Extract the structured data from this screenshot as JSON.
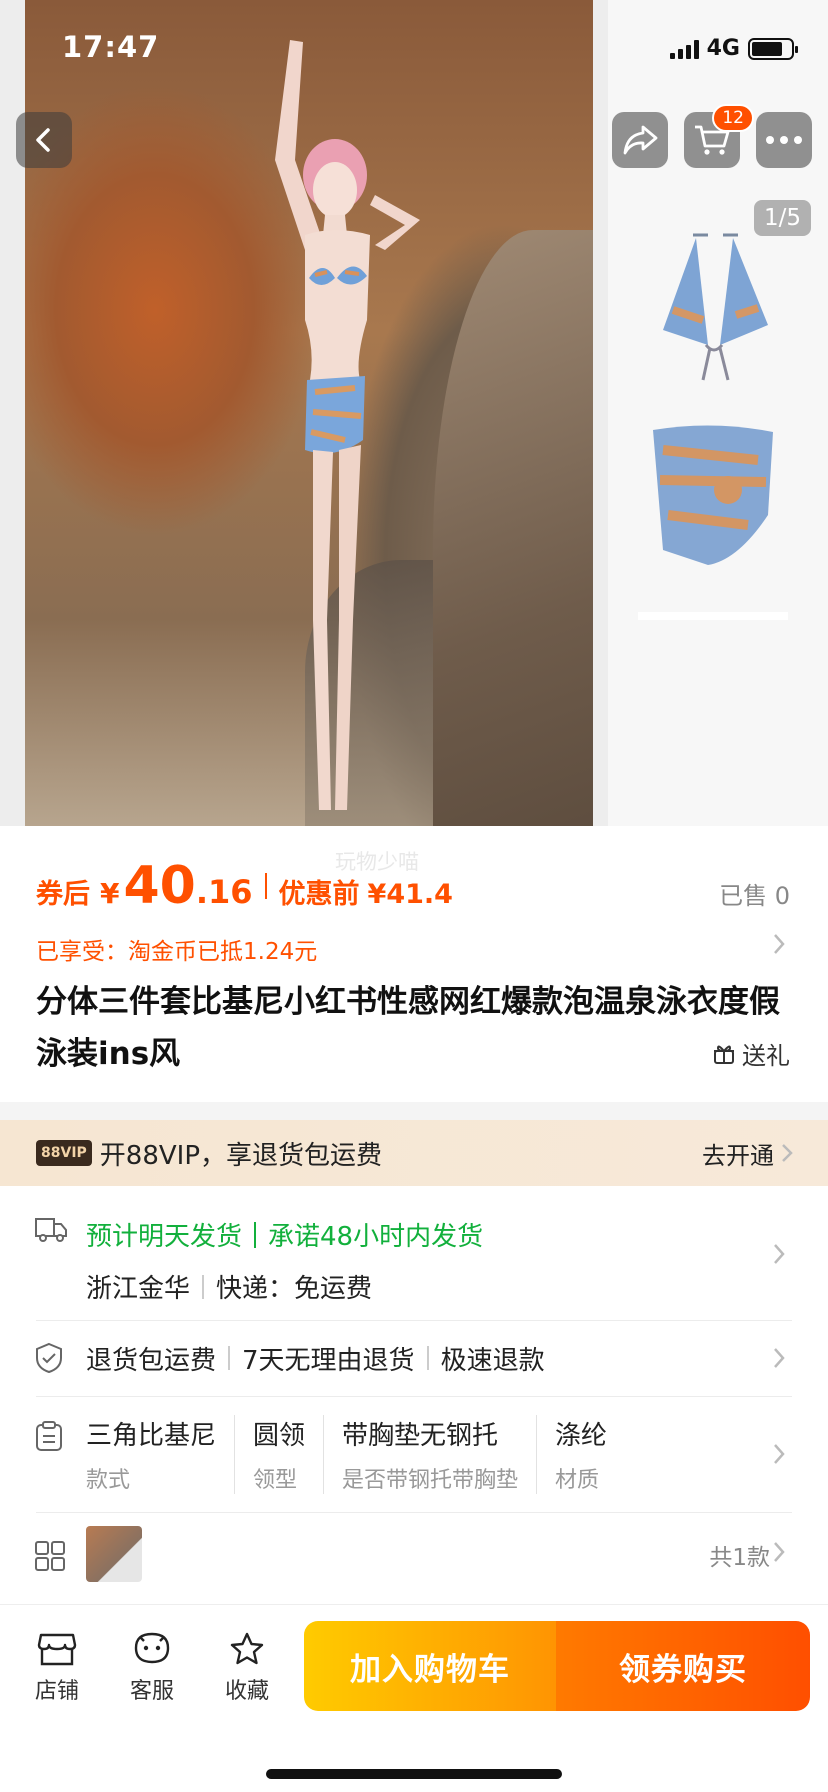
{
  "status_bar": {
    "time": "17:47",
    "network": "4G",
    "battery_level": 0.8
  },
  "top_nav": {
    "cart_badge": "12"
  },
  "gallery": {
    "counter": "1/5",
    "watermark": "玩物少喵"
  },
  "price": {
    "coupon_label": "券后",
    "currency": "¥",
    "integer": "40",
    "decimal": ".16",
    "orig_label": "优惠前",
    "orig_value": "¥41.4",
    "sold": "已售 0",
    "coin_note": "已享受：淘金币已抵1.24元"
  },
  "product": {
    "title": "分体三件套比基尼小红书性感网红爆款泡温泉泳衣度假泳装ins风",
    "gift_label": "送礼"
  },
  "vip": {
    "tag": "88VIP",
    "text": "开88VIP，享退货包运费",
    "cta": "去开通"
  },
  "shipping": {
    "estimate": "预计明天发货",
    "promise": "承诺48小时内发货",
    "origin": "浙江金华",
    "express": "快递：免运费"
  },
  "services": [
    "退货包运费",
    "7天无理由退货",
    "极速退款"
  ],
  "attributes": [
    {
      "value": "三角比基尼",
      "key": "款式"
    },
    {
      "value": "圆领",
      "key": "领型"
    },
    {
      "value": "带胸垫无钢托",
      "key": "是否带钢托带胸垫"
    },
    {
      "value": "涤纶",
      "key": "材质"
    }
  ],
  "sku": {
    "count": "共1款"
  },
  "bottom_bar": {
    "store": "店铺",
    "service": "客服",
    "favorite": "收藏",
    "add_to_cart": "加入购物车",
    "buy_now": "领券购买"
  },
  "colors": {
    "accent": "#ff5000",
    "green": "#12b03c",
    "cart_grad_start": "#ffcb00",
    "buy_grad_end": "#ff4f00"
  }
}
